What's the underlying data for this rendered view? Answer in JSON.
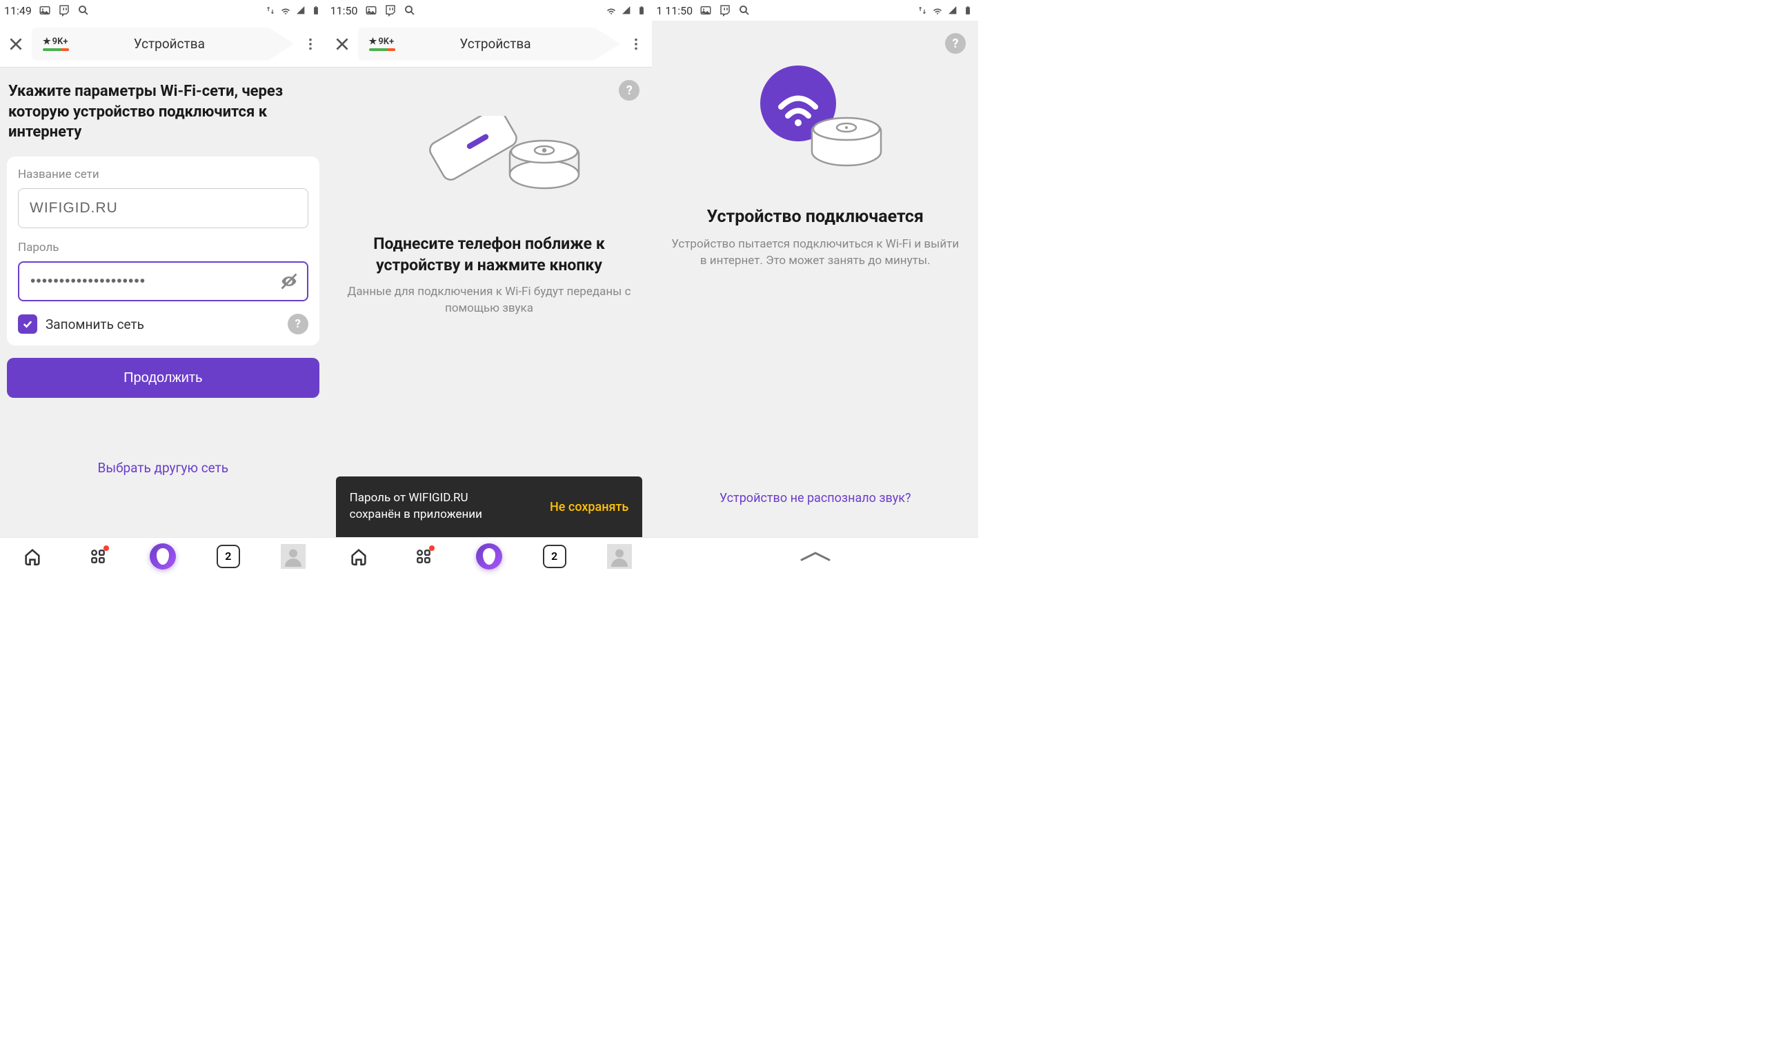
{
  "screen1": {
    "status": {
      "time": "11:49"
    },
    "tab": {
      "rating": "9K+",
      "title": "Устройства"
    },
    "heading": "Укажите параметры Wi-Fi-сети, через которую устройство подключится к интернету",
    "form": {
      "network_label": "Название сети",
      "network_value": "WIFIGID.RU",
      "password_label": "Пароль",
      "password_value": "••••••••••••••••••••",
      "remember_label": "Запомнить сеть",
      "continue_label": "Продолжить"
    },
    "alt_link": "Выбрать другую сеть",
    "nav_tabcount": "2"
  },
  "screen2": {
    "status": {
      "time": "11:50"
    },
    "tab": {
      "rating": "9K+",
      "title": "Устройства"
    },
    "instr_heading": "Поднесите телефон поближе к устройству и нажмите кнопку",
    "instr_sub": "Данные для подключения к Wi-Fi будут переданы с помощью звука",
    "toast": {
      "line1": "Пароль от WIFIGID.RU",
      "line2": "сохранён в приложении",
      "action": "Не сохранять"
    },
    "nav_tabcount": "2"
  },
  "screen3": {
    "status": {
      "time_prefix": "1 11:50"
    },
    "connect_heading": "Устройство подключается",
    "connect_sub": "Устройство пытается подключиться к Wi-Fi и выйти в интернет. Это может занять до минуты.",
    "bottom_link": "Устройство не распознало звук?"
  }
}
